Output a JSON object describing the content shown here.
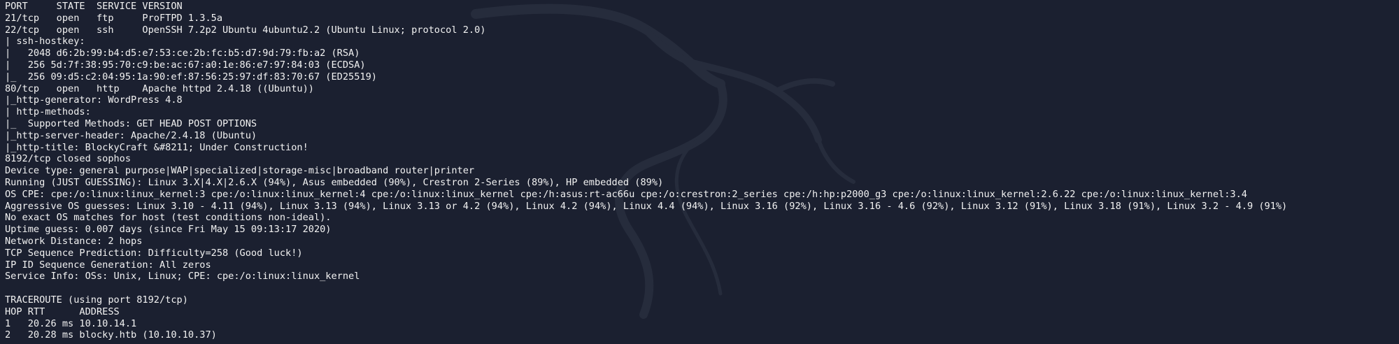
{
  "terminal": {
    "lines": [
      "PORT     STATE  SERVICE VERSION",
      "21/tcp   open   ftp     ProFTPD 1.3.5a",
      "22/tcp   open   ssh     OpenSSH 7.2p2 Ubuntu 4ubuntu2.2 (Ubuntu Linux; protocol 2.0)",
      "| ssh-hostkey: ",
      "|   2048 d6:2b:99:b4:d5:e7:53:ce:2b:fc:b5:d7:9d:79:fb:a2 (RSA)",
      "|   256 5d:7f:38:95:70:c9:be:ac:67:a0:1e:86:e7:97:84:03 (ECDSA)",
      "|_  256 09:d5:c2:04:95:1a:90:ef:87:56:25:97:df:83:70:67 (ED25519)",
      "80/tcp   open   http    Apache httpd 2.4.18 ((Ubuntu))",
      "|_http-generator: WordPress 4.8",
      "| http-methods: ",
      "|_  Supported Methods: GET HEAD POST OPTIONS",
      "|_http-server-header: Apache/2.4.18 (Ubuntu)",
      "|_http-title: BlockyCraft &#8211; Under Construction!",
      "8192/tcp closed sophos",
      "Device type: general purpose|WAP|specialized|storage-misc|broadband router|printer",
      "Running (JUST GUESSING): Linux 3.X|4.X|2.6.X (94%), Asus embedded (90%), Crestron 2-Series (89%), HP embedded (89%)",
      "OS CPE: cpe:/o:linux:linux_kernel:3 cpe:/o:linux:linux_kernel:4 cpe:/o:linux:linux_kernel cpe:/h:asus:rt-ac66u cpe:/o:crestron:2_series cpe:/h:hp:p2000_g3 cpe:/o:linux:linux_kernel:2.6.22 cpe:/o:linux:linux_kernel:3.4",
      "Aggressive OS guesses: Linux 3.10 - 4.11 (94%), Linux 3.13 (94%), Linux 3.13 or 4.2 (94%), Linux 4.2 (94%), Linux 4.4 (94%), Linux 3.16 (92%), Linux 3.16 - 4.6 (92%), Linux 3.12 (91%), Linux 3.18 (91%), Linux 3.2 - 4.9 (91%)",
      "No exact OS matches for host (test conditions non-ideal).",
      "Uptime guess: 0.007 days (since Fri May 15 09:13:17 2020)",
      "Network Distance: 2 hops",
      "TCP Sequence Prediction: Difficulty=258 (Good luck!)",
      "IP ID Sequence Generation: All zeros",
      "Service Info: OSs: Unix, Linux; CPE: cpe:/o:linux:linux_kernel",
      "",
      "TRACEROUTE (using port 8192/tcp)",
      "HOP RTT      ADDRESS",
      "1   20.26 ms 10.10.14.1",
      "2   20.28 ms blocky.htb (10.10.10.37)"
    ]
  },
  "colors": {
    "background": "#1b2030",
    "text": "#f2f2f2",
    "watermark": "#2a3040"
  },
  "icons": {
    "watermark": "kali-dragon-logo"
  }
}
